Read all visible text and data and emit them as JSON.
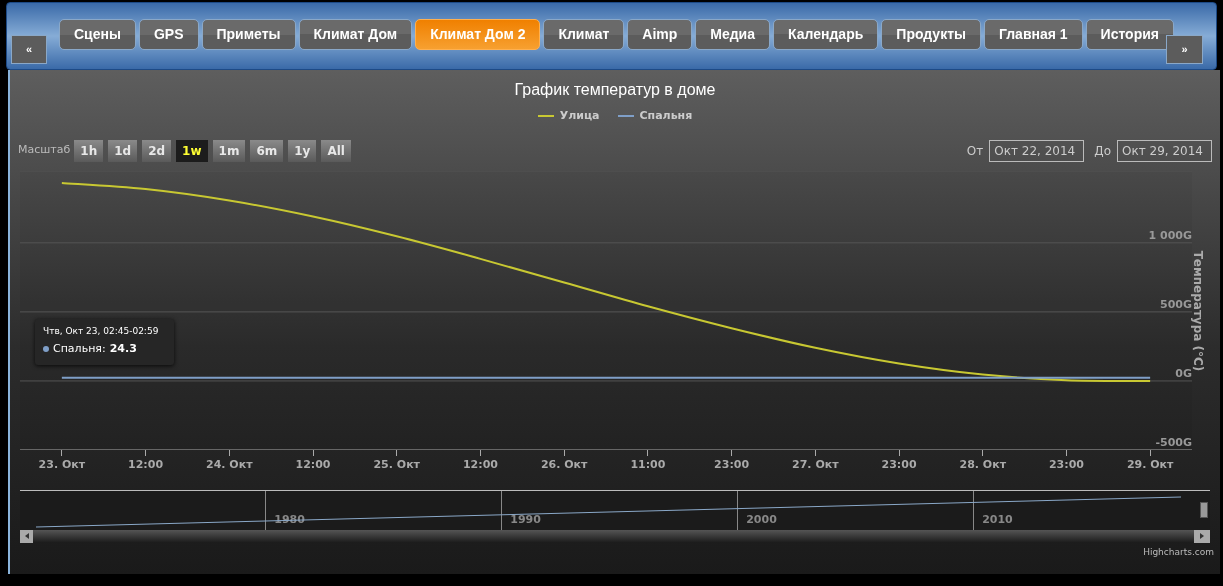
{
  "tabs": [
    {
      "label": "Сцены",
      "selected": false
    },
    {
      "label": "GPS",
      "selected": false
    },
    {
      "label": "Приметы",
      "selected": false
    },
    {
      "label": "Климат Дом",
      "selected": false
    },
    {
      "label": "Климат Дом 2",
      "selected": true
    },
    {
      "label": "Климат",
      "selected": false
    },
    {
      "label": "Aimp",
      "selected": false
    },
    {
      "label": "Медиа",
      "selected": false
    },
    {
      "label": "Календарь",
      "selected": false
    },
    {
      "label": "Продукты",
      "selected": false
    },
    {
      "label": "Главная 1",
      "selected": false
    },
    {
      "label": "История",
      "selected": false
    }
  ],
  "scroll_left": "«",
  "scroll_right": "»",
  "chart": {
    "range_label": "Масштаб",
    "range_buttons": [
      {
        "label": "1h",
        "selected": false
      },
      {
        "label": "1d",
        "selected": false
      },
      {
        "label": "2d",
        "selected": false
      },
      {
        "label": "1w",
        "selected": true
      },
      {
        "label": "1m",
        "selected": false
      },
      {
        "label": "6m",
        "selected": false
      },
      {
        "label": "1y",
        "selected": false
      },
      {
        "label": "All",
        "selected": false
      }
    ],
    "from_label": "От",
    "from_value": "Окт 22, 2014",
    "to_label": "До",
    "to_value": "Окт 29, 2014",
    "tooltip": {
      "header": "Чтв, Окт 23, 02:45-02:59",
      "series": "Спальня:",
      "value": "24.3",
      "color": "#7f9fc8"
    },
    "chart_data": {
      "type": "line",
      "title": "График температур в доме",
      "ylabel": "Температура (°C)",
      "categories": [
        "23. Окт",
        "12:00",
        "24. Окт",
        "12:00",
        "25. Окт",
        "12:00",
        "26. Окт",
        "11:00",
        "23:00",
        "27. Окт",
        "23:00",
        "28. Окт",
        "23:00",
        "29. Окт"
      ],
      "grid": true,
      "series": [
        {
          "name": "Улица",
          "color": "#c8c832",
          "values": [
            1433,
            1389,
            1306,
            1190,
            1047,
            884,
            713,
            541,
            382,
            240,
            126,
            46,
            5,
            0
          ]
        },
        {
          "name": "Спальня",
          "color": "#7f9fc8",
          "values": [
            24,
            24,
            24,
            24,
            24,
            24,
            24,
            24,
            24,
            24,
            24,
            24,
            24,
            24
          ]
        }
      ],
      "ylim": [
        -500,
        1520
      ],
      "yticks": [
        {
          "value": -500,
          "label": "-500G"
        },
        {
          "value": 0,
          "label": "0G"
        },
        {
          "value": 500,
          "label": "500G"
        },
        {
          "value": 1000,
          "label": "1 000G"
        }
      ]
    },
    "navigator_labels": [
      "1980",
      "1990",
      "2000",
      "2010"
    ],
    "credit": "Highcharts.com"
  }
}
